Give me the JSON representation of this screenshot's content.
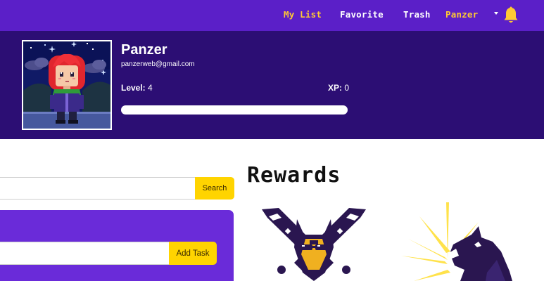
{
  "nav": {
    "my_list": "My List",
    "favorite": "Favorite",
    "trash": "Trash",
    "user": "Panzer",
    "bell_icon": "bell-icon",
    "accent_color": "#ffc933"
  },
  "profile": {
    "name": "Panzer",
    "email": "panzerweb@gmail.com",
    "level_label": "Level:",
    "level_value": "4",
    "xp_label": "XP:",
    "xp_value": "0",
    "xp_progress": 0
  },
  "search": {
    "placeholder": "",
    "button_label": "Search"
  },
  "tasks": {
    "input_placeholder": "",
    "add_label": "Add Task"
  },
  "rewards": {
    "title": "Rewards",
    "badges": [
      {
        "icon": "crossed-blades-wolf-badge-icon"
      },
      {
        "icon": "howling-wolf-badge-icon"
      }
    ]
  },
  "colors": {
    "nav_bg": "#5b1fc8",
    "profile_bg": "#2c0e74",
    "button_yellow": "#ffd400",
    "card_purple": "#6a2bd9"
  }
}
